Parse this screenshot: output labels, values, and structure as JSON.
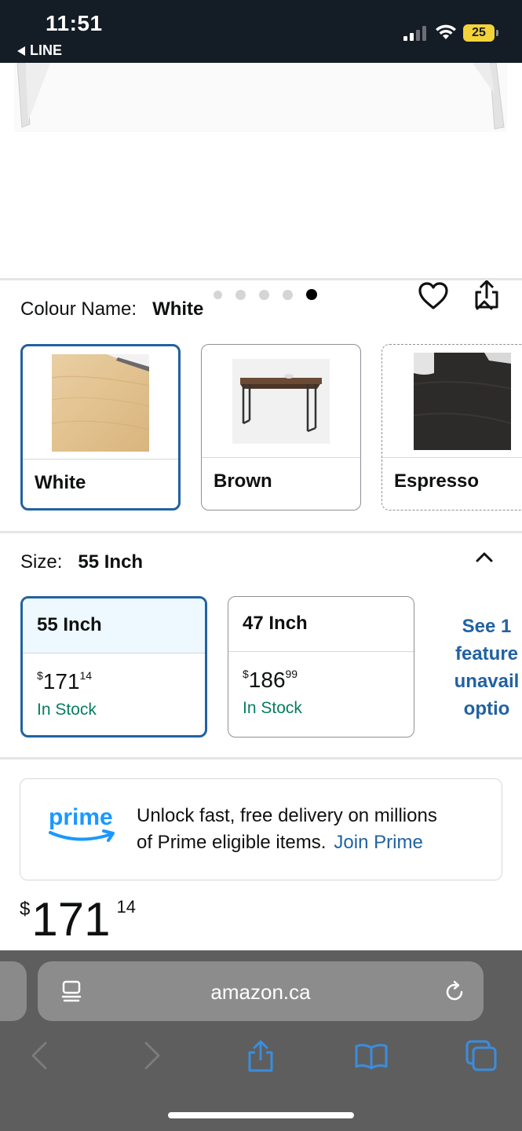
{
  "status_bar": {
    "time": "11:51",
    "back_app": "LINE",
    "battery": "25"
  },
  "gallery": {
    "dot_count": 5,
    "active_dot": 5
  },
  "colour": {
    "label": "Colour Name:",
    "selected": "White",
    "options": [
      {
        "label": "White",
        "selected": true,
        "available": true
      },
      {
        "label": "Brown",
        "selected": false,
        "available": true
      },
      {
        "label": "Espresso",
        "selected": false,
        "available": false
      }
    ]
  },
  "size": {
    "label": "Size:",
    "selected": "55 Inch",
    "options": [
      {
        "label": "55 Inch",
        "price_currency": "$",
        "price_whole": "171",
        "price_cents": "14",
        "stock": "In Stock",
        "selected": true
      },
      {
        "label": "47 Inch",
        "price_currency": "$",
        "price_whole": "186",
        "price_cents": "99",
        "stock": "In Stock",
        "selected": false
      }
    ],
    "see_more_lines": [
      "See 1",
      "feature",
      "unavail",
      "optio"
    ]
  },
  "prime": {
    "logo_text": "prime",
    "line1": "Unlock fast, free delivery on millions",
    "line2": "of Prime eligible items.",
    "link": "Join Prime"
  },
  "price": {
    "currency": "$",
    "whole": "171",
    "cents": "14"
  },
  "browser": {
    "url": "amazon.ca"
  },
  "colors": {
    "accent_blue": "#2162a1",
    "stock_green": "#067d62",
    "status_bar_bg": "#141c25",
    "prime_blue": "#1a98ff",
    "ios_link_blue": "#3a8dde"
  }
}
